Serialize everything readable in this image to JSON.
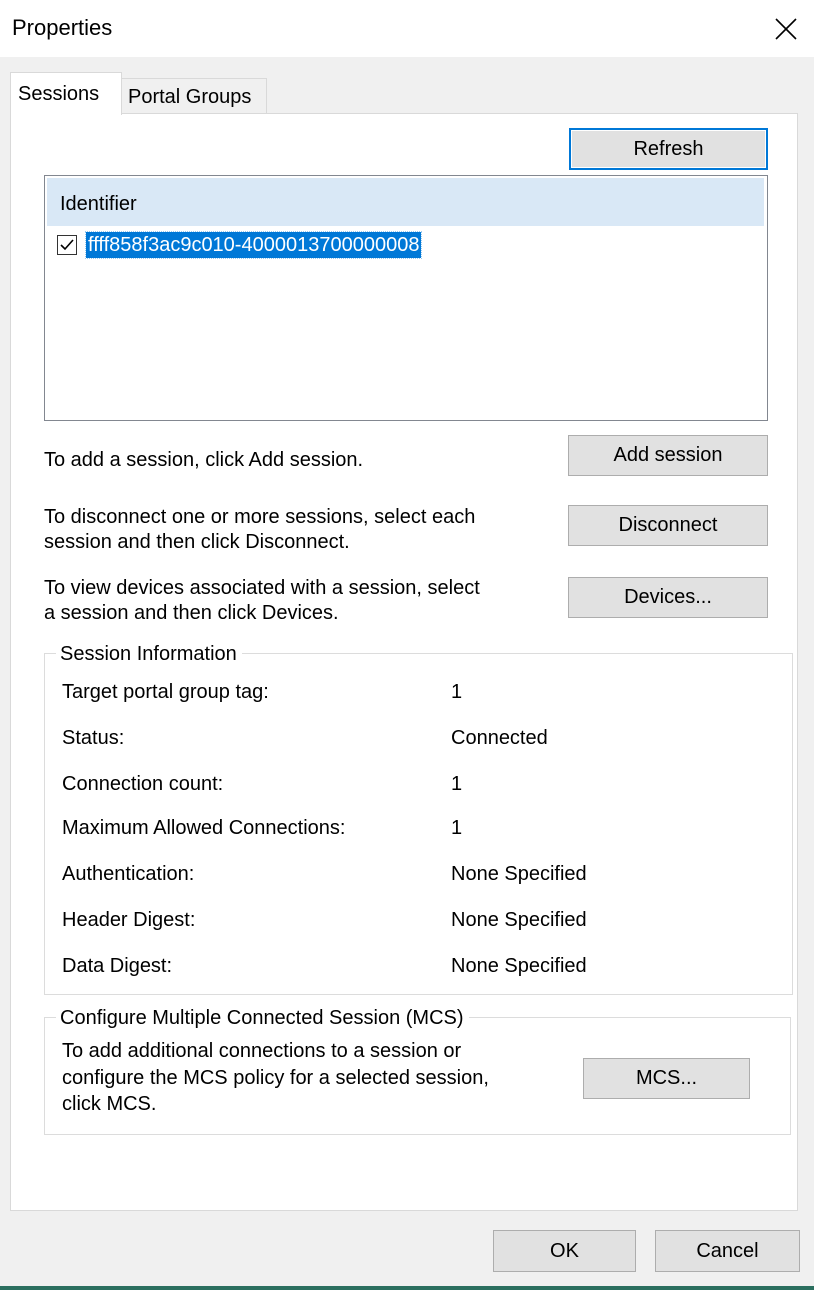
{
  "window": {
    "title": "Properties"
  },
  "tabs": [
    {
      "label": "Sessions",
      "active": true
    },
    {
      "label": "Portal Groups",
      "active": false
    }
  ],
  "sessions": {
    "refresh_label": "Refresh",
    "list": {
      "column_header": "Identifier",
      "items": [
        {
          "identifier": "ffff858f3ac9c010-4000013700000008",
          "checked": true,
          "selected": true
        }
      ]
    },
    "add_help": "To add a session, click Add session.",
    "add_label": "Add session",
    "disconnect_help_line1": "To disconnect one or more sessions, select each",
    "disconnect_help_line2": "session and then click Disconnect.",
    "disconnect_label": "Disconnect",
    "devices_help_line1": "To view devices associated with a session, select",
    "devices_help_line2": "a session and then click Devices.",
    "devices_label": "Devices..."
  },
  "session_info": {
    "group_title": "Session Information",
    "rows": [
      {
        "label": "Target portal group tag:",
        "value": "1"
      },
      {
        "label": "Status:",
        "value": "Connected"
      },
      {
        "label": "Connection count:",
        "value": "1"
      },
      {
        "label": "Maximum Allowed Connections:",
        "value": "1"
      },
      {
        "label": "Authentication:",
        "value": "None Specified"
      },
      {
        "label": "Header Digest:",
        "value": "None Specified"
      },
      {
        "label": "Data Digest:",
        "value": "None Specified"
      }
    ]
  },
  "mcs": {
    "group_title": "Configure Multiple Connected Session (MCS)",
    "help_line1": "To add additional connections to a session or",
    "help_line2": "configure the MCS policy for a selected session,",
    "help_line3": "click MCS.",
    "button_label": "MCS..."
  },
  "footer": {
    "ok_label": "OK",
    "cancel_label": "Cancel"
  },
  "colors": {
    "selection": "#0078d7",
    "header_bg": "#d9e8f6",
    "dialog_bg": "#f0f0f0"
  }
}
